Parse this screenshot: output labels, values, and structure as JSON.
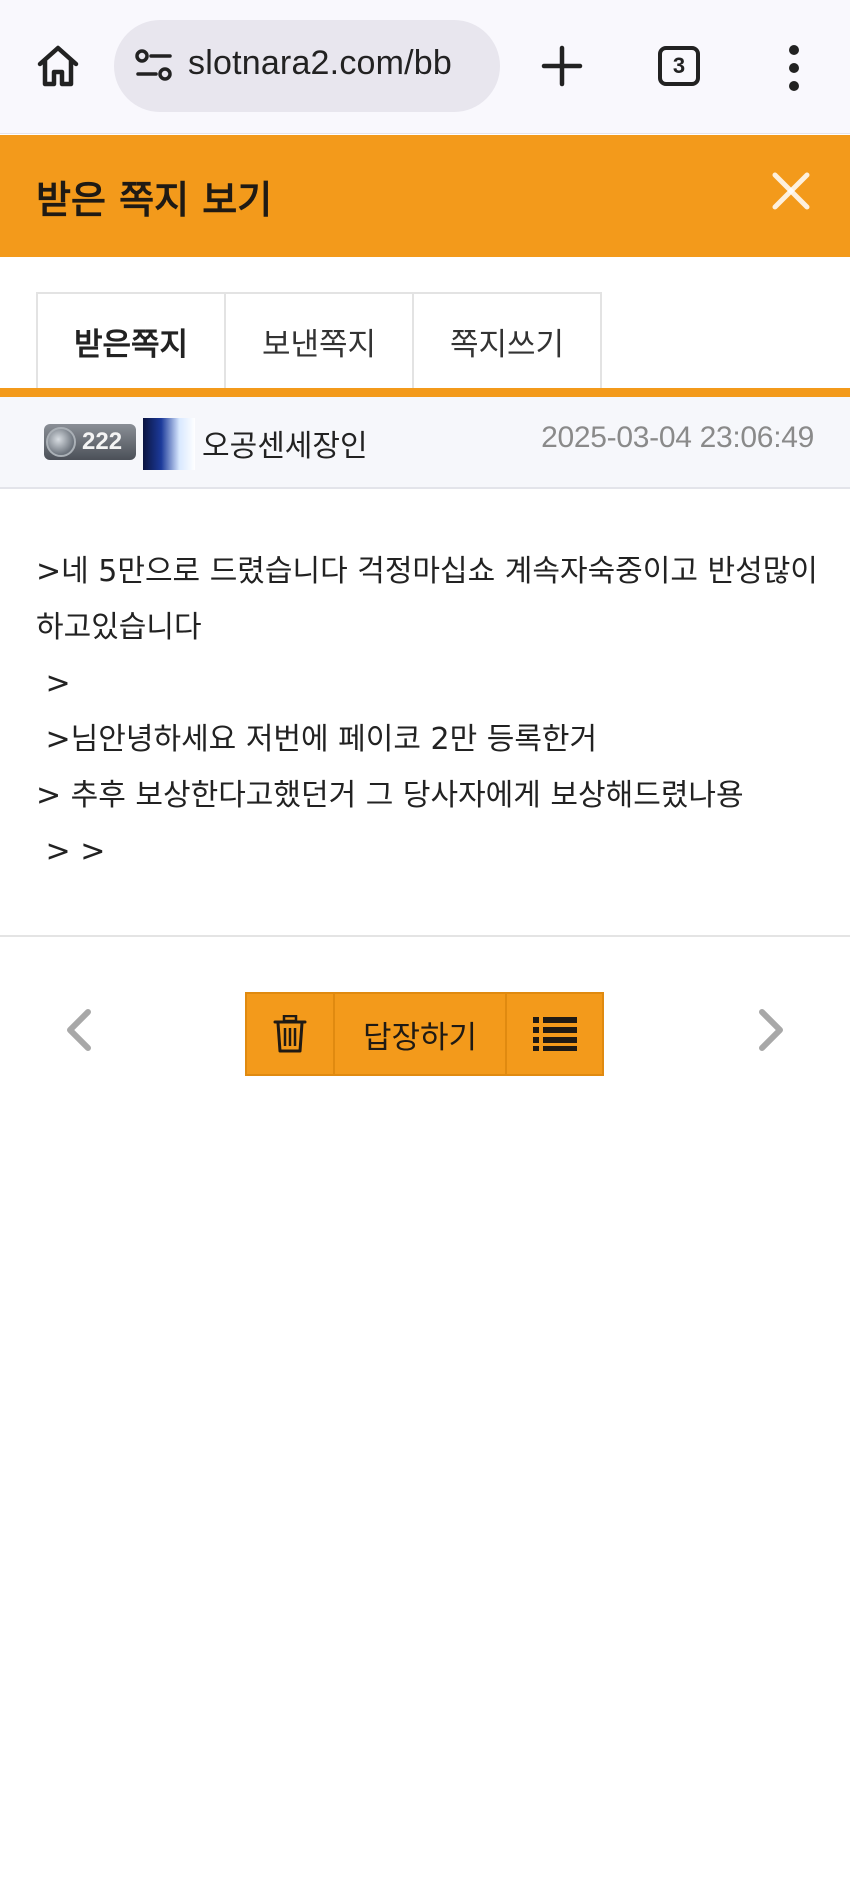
{
  "browser": {
    "url": "slotnara2.com/bb",
    "tab_count": "3",
    "icons": [
      "home-icon",
      "site-settings-icon",
      "plus-icon",
      "tab-switcher-icon",
      "more-vert-icon"
    ]
  },
  "header": {
    "title": "받은 쪽지 보기",
    "close_icon": "close-icon",
    "accent_color": "#f39a1b"
  },
  "tabs": [
    {
      "label": "받은쪽지",
      "active": true
    },
    {
      "label": "보낸쪽지",
      "active": false
    },
    {
      "label": "쪽지쓰기",
      "active": false
    }
  ],
  "message": {
    "level": "222",
    "sender": "오공센세장인",
    "date": "2025-03-04 23:06:49",
    "lines": [
      ">네 5만으로 드렸습니다 걱정마십쇼 계속자숙중이고 반성많이하고있습니다",
      " >",
      " >님안녕하세요 저번에 페이코 2만 등록한거",
      "> 추후 보상한다고했던거 그 당사자에게 보상해드렸나용",
      " > >"
    ]
  },
  "actions": {
    "reply_label": "답장하기",
    "icons": [
      "chevron-left-icon",
      "trash-icon",
      "list-icon",
      "chevron-right-icon"
    ]
  }
}
